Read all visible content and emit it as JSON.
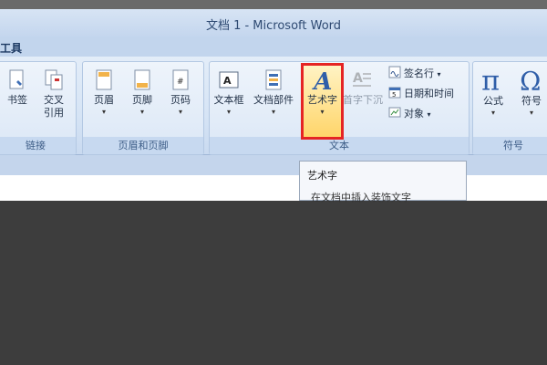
{
  "window": {
    "title": "文档 1 - Microsoft Word"
  },
  "tab": {
    "label": "工具"
  },
  "groups": {
    "links": {
      "label": "链接",
      "bookmark": "书签",
      "crossref_line1": "交叉",
      "crossref_line2": "引用"
    },
    "header_footer": {
      "label": "页眉和页脚",
      "header": "页眉",
      "footer": "页脚",
      "page_number": "页码"
    },
    "text": {
      "label": "文本",
      "textbox": "文本框",
      "quick_parts": "文档部件",
      "wordart": "艺术字",
      "dropcap": "首字下沉",
      "signature_line": "签名行",
      "datetime": "日期和时间",
      "object": "对象"
    },
    "symbols": {
      "label": "符号",
      "equation": "公式",
      "symbol": "符号"
    }
  },
  "tooltip": {
    "title": "艺术字",
    "description": "在文档中插入装饰文字"
  },
  "highlight": {
    "color": "#e52424",
    "target": "wordart-button"
  }
}
